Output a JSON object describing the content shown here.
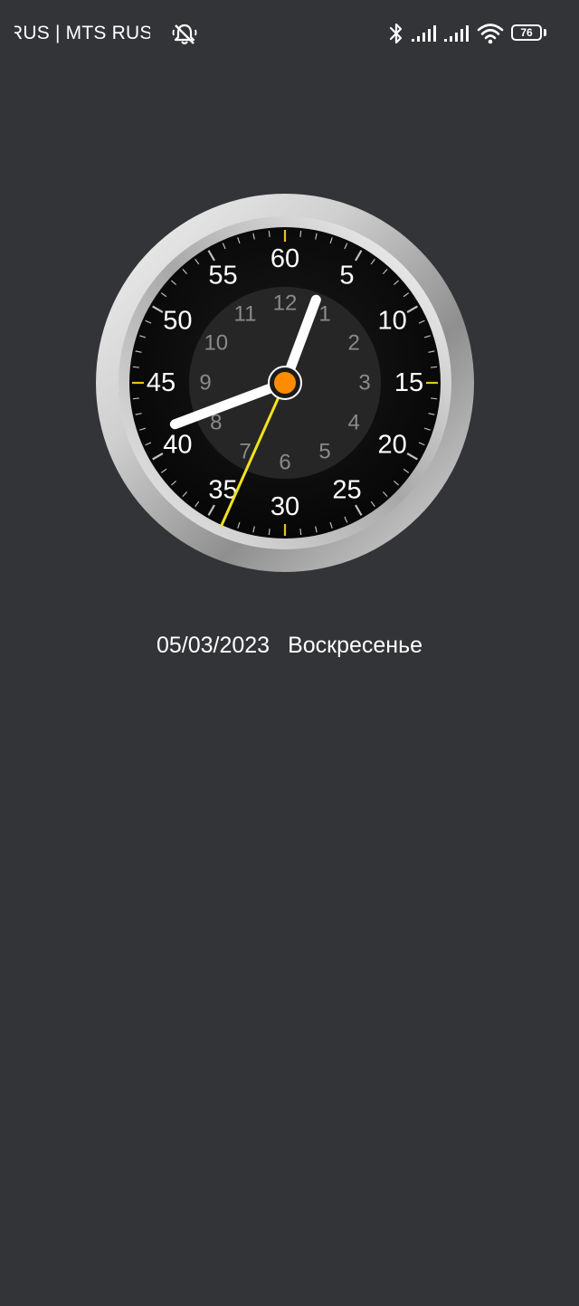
{
  "status_bar": {
    "carrier_text": "RUS | MTS RUS",
    "icons": [
      "notifications-off-icon",
      "bluetooth-icon",
      "signal-icon",
      "signal-icon",
      "wifi-icon",
      "battery-icon"
    ],
    "battery_level": "76"
  },
  "clock": {
    "outer_numbers": [
      "60",
      "5",
      "10",
      "15",
      "20",
      "25",
      "30",
      "35",
      "40",
      "45",
      "50",
      "55"
    ],
    "inner_numbers": [
      "12",
      "1",
      "2",
      "3",
      "4",
      "5",
      "6",
      "7",
      "8",
      "9",
      "10",
      "11"
    ],
    "time": {
      "hour": 12,
      "minute": 41,
      "second": 34
    },
    "colors": {
      "bezel": "#d9d9d9",
      "dial": "#0b0b0b",
      "inner_dial": "#262626",
      "hands": "#ffffff",
      "second_hand": "#f2e21c",
      "center_cap": "#ff8c00",
      "tick_accent": "#e8c21a"
    }
  },
  "date_line": {
    "date": "05/03/2023",
    "weekday": "Воскресенье"
  }
}
